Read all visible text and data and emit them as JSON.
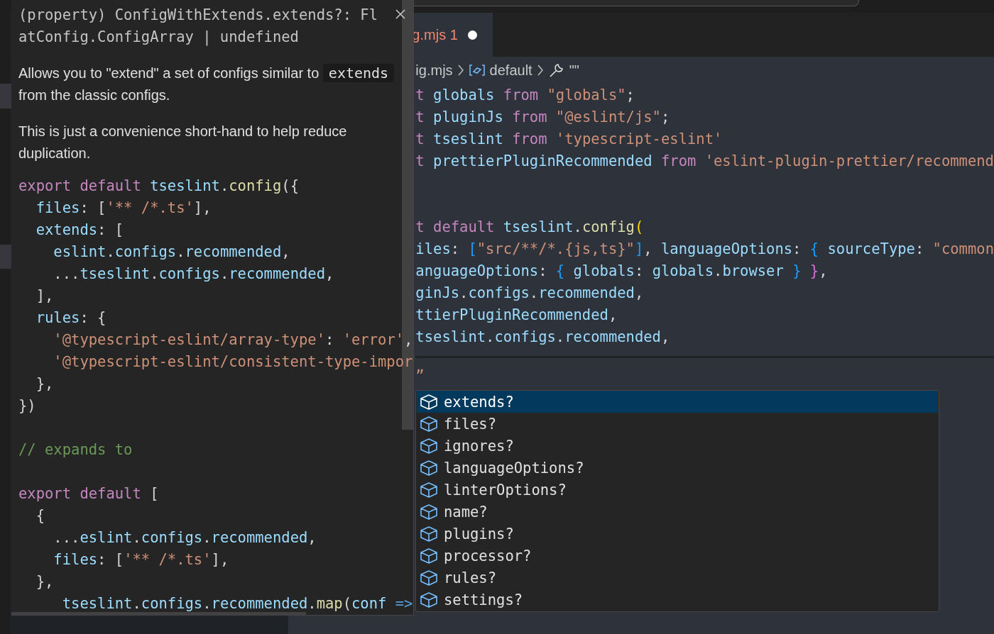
{
  "tab": {
    "label": "g.mjs 1",
    "modified": true
  },
  "breadcrumb": [
    {
      "kind": "file",
      "label": "ig.mjs"
    },
    {
      "kind": "symbol",
      "label": "default"
    },
    {
      "kind": "property",
      "label": "\"\""
    }
  ],
  "editor_blocks": [
    {
      "lines": [
        [
          {
            "kind": "kw",
            "text": "t "
          },
          {
            "kind": "var",
            "text": "globals "
          },
          {
            "kind": "kw",
            "text": "from "
          },
          {
            "kind": "str",
            "text": "\"globals\""
          },
          {
            "kind": "punct",
            "text": ";"
          }
        ],
        [
          {
            "kind": "kw",
            "text": "t "
          },
          {
            "kind": "var",
            "text": "pluginJs "
          },
          {
            "kind": "kw",
            "text": "from "
          },
          {
            "kind": "str",
            "text": "\"@eslint/js\""
          },
          {
            "kind": "punct",
            "text": ";"
          }
        ],
        [
          {
            "kind": "kw",
            "text": "t "
          },
          {
            "kind": "var",
            "text": "tseslint "
          },
          {
            "kind": "kw",
            "text": "from "
          },
          {
            "kind": "str",
            "text": "'typescript-eslint'"
          }
        ],
        [
          {
            "kind": "kw",
            "text": "t "
          },
          {
            "kind": "var",
            "text": "prettierPluginRecommended "
          },
          {
            "kind": "kw",
            "text": "from "
          },
          {
            "kind": "str",
            "text": "'eslint-plugin-prettier/recommend"
          }
        ]
      ]
    },
    {
      "lines": [
        [
          {
            "kind": "kw",
            "text": "t default "
          },
          {
            "kind": "var",
            "text": "tseslint"
          },
          {
            "kind": "punct",
            "text": "."
          },
          {
            "kind": "fn",
            "text": "config"
          },
          {
            "kind": "gold",
            "text": "("
          }
        ],
        [
          {
            "kind": "var",
            "text": "iles"
          },
          {
            "kind": "punct",
            "text": ": "
          },
          {
            "kind": "blue",
            "text": "["
          },
          {
            "kind": "str",
            "text": "\"src/**/*.{js,ts}\""
          },
          {
            "kind": "blue",
            "text": "]"
          },
          {
            "kind": "punct",
            "text": ", "
          },
          {
            "kind": "var",
            "text": "languageOptions"
          },
          {
            "kind": "punct",
            "text": ": "
          },
          {
            "kind": "blue",
            "text": "{ "
          },
          {
            "kind": "var",
            "text": "sourceType"
          },
          {
            "kind": "punct",
            "text": ": "
          },
          {
            "kind": "str",
            "text": "\"common"
          }
        ],
        [
          {
            "kind": "var",
            "text": "anguageOptions"
          },
          {
            "kind": "punct",
            "text": ": "
          },
          {
            "kind": "blue",
            "text": "{ "
          },
          {
            "kind": "var",
            "text": "globals"
          },
          {
            "kind": "punct",
            "text": ": "
          },
          {
            "kind": "var",
            "text": "globals"
          },
          {
            "kind": "punct",
            "text": "."
          },
          {
            "kind": "var",
            "text": "browser "
          },
          {
            "kind": "blue",
            "text": "} "
          },
          {
            "kind": "pink",
            "text": "}"
          },
          {
            "kind": "punct",
            "text": ","
          }
        ],
        [
          {
            "kind": "var",
            "text": "ginJs"
          },
          {
            "kind": "punct",
            "text": "."
          },
          {
            "kind": "var",
            "text": "configs"
          },
          {
            "kind": "punct",
            "text": "."
          },
          {
            "kind": "var",
            "text": "recommended"
          },
          {
            "kind": "punct",
            "text": ","
          }
        ],
        [
          {
            "kind": "var",
            "text": "ttierPluginRecommended"
          },
          {
            "kind": "punct",
            "text": ","
          }
        ],
        [
          {
            "kind": "var",
            "text": "tseslint"
          },
          {
            "kind": "punct",
            "text": "."
          },
          {
            "kind": "var",
            "text": "configs"
          },
          {
            "kind": "punct",
            "text": "."
          },
          {
            "kind": "var",
            "text": "recommended"
          },
          {
            "kind": "punct",
            "text": ","
          }
        ]
      ]
    },
    {
      "lines": [
        [
          {
            "kind": "str",
            "text": "„"
          }
        ]
      ]
    }
  ],
  "hover": {
    "signature": "(property) ConfigWithExtends.extends?: FlatConfig.ConfigArray | undefined",
    "paragraphs": [
      [
        {
          "kind": "text",
          "text": "Allows you to \"extend\" a set of configs similar to "
        },
        {
          "kind": "code",
          "text": "extends"
        },
        {
          "kind": "text",
          "text": " from the classic configs."
        }
      ],
      [
        {
          "kind": "text",
          "text": "This is just a convenience short-hand to help reduce duplication."
        }
      ]
    ],
    "code_blocks": [
      [
        [
          {
            "kind": "kw",
            "text": "export default "
          },
          {
            "kind": "var",
            "text": "tseslint"
          },
          {
            "kind": "punct",
            "text": "."
          },
          {
            "kind": "fn",
            "text": "config"
          },
          {
            "kind": "punct",
            "text": "({"
          }
        ],
        [
          {
            "kind": "var",
            "text": "  files"
          },
          {
            "kind": "punct",
            "text": ": ["
          },
          {
            "kind": "str",
            "text": "'** /*.ts'"
          },
          {
            "kind": "punct",
            "text": "],"
          }
        ],
        [
          {
            "kind": "var",
            "text": "  extends"
          },
          {
            "kind": "punct",
            "text": ": ["
          }
        ],
        [
          {
            "kind": "var",
            "text": "    eslint"
          },
          {
            "kind": "punct",
            "text": "."
          },
          {
            "kind": "var",
            "text": "configs"
          },
          {
            "kind": "punct",
            "text": "."
          },
          {
            "kind": "var",
            "text": "recommended"
          },
          {
            "kind": "punct",
            "text": ","
          }
        ],
        [
          {
            "kind": "punct",
            "text": "    ..."
          },
          {
            "kind": "var",
            "text": "tseslint"
          },
          {
            "kind": "punct",
            "text": "."
          },
          {
            "kind": "var",
            "text": "configs"
          },
          {
            "kind": "punct",
            "text": "."
          },
          {
            "kind": "var",
            "text": "recommended"
          },
          {
            "kind": "punct",
            "text": ","
          }
        ],
        [
          {
            "kind": "punct",
            "text": "  ],"
          }
        ],
        [
          {
            "kind": "var",
            "text": "  rules"
          },
          {
            "kind": "punct",
            "text": ": {"
          }
        ],
        [
          {
            "kind": "str",
            "text": "    '@typescript-eslint/array-type'"
          },
          {
            "kind": "punct",
            "text": ": "
          },
          {
            "kind": "str",
            "text": "'error'"
          },
          {
            "kind": "punct",
            "text": ","
          }
        ],
        [
          {
            "kind": "str",
            "text": "    '@typescript-eslint/consistent-type-impor"
          }
        ],
        [
          {
            "kind": "punct",
            "text": "  },"
          }
        ],
        [
          {
            "kind": "punct",
            "text": "})"
          }
        ]
      ],
      [
        [
          {
            "kind": "comment",
            "text": "// expands to"
          }
        ]
      ],
      [
        [
          {
            "kind": "kw",
            "text": "export default "
          },
          {
            "kind": "punct",
            "text": "["
          }
        ],
        [
          {
            "kind": "punct",
            "text": "  {"
          }
        ],
        [
          {
            "kind": "punct",
            "text": "    ..."
          },
          {
            "kind": "var",
            "text": "eslint"
          },
          {
            "kind": "punct",
            "text": "."
          },
          {
            "kind": "var",
            "text": "configs"
          },
          {
            "kind": "punct",
            "text": "."
          },
          {
            "kind": "var",
            "text": "recommended"
          },
          {
            "kind": "punct",
            "text": ","
          }
        ],
        [
          {
            "kind": "var",
            "text": "    files"
          },
          {
            "kind": "punct",
            "text": ": ["
          },
          {
            "kind": "str",
            "text": "'** /*.ts'"
          },
          {
            "kind": "punct",
            "text": "],"
          }
        ],
        [
          {
            "kind": "punct",
            "text": "  },"
          }
        ],
        [
          {
            "kind": "var",
            "text": "     tseslint"
          },
          {
            "kind": "punct",
            "text": "."
          },
          {
            "kind": "var",
            "text": "configs"
          },
          {
            "kind": "punct",
            "text": "."
          },
          {
            "kind": "var",
            "text": "recommended"
          },
          {
            "kind": "punct",
            "text": "."
          },
          {
            "kind": "fn",
            "text": "map"
          },
          {
            "kind": "punct",
            "text": "("
          },
          {
            "kind": "var",
            "text": "conf "
          },
          {
            "kind": "kw2",
            "text": "=>"
          }
        ]
      ]
    ]
  },
  "suggestions": [
    {
      "label": "extends?",
      "selected": true
    },
    {
      "label": "files?",
      "selected": false
    },
    {
      "label": "ignores?",
      "selected": false
    },
    {
      "label": "languageOptions?",
      "selected": false
    },
    {
      "label": "linterOptions?",
      "selected": false
    },
    {
      "label": "name?",
      "selected": false
    },
    {
      "label": "plugins?",
      "selected": false
    },
    {
      "label": "processor?",
      "selected": false
    },
    {
      "label": "rules?",
      "selected": false
    },
    {
      "label": "settings?",
      "selected": false
    }
  ]
}
